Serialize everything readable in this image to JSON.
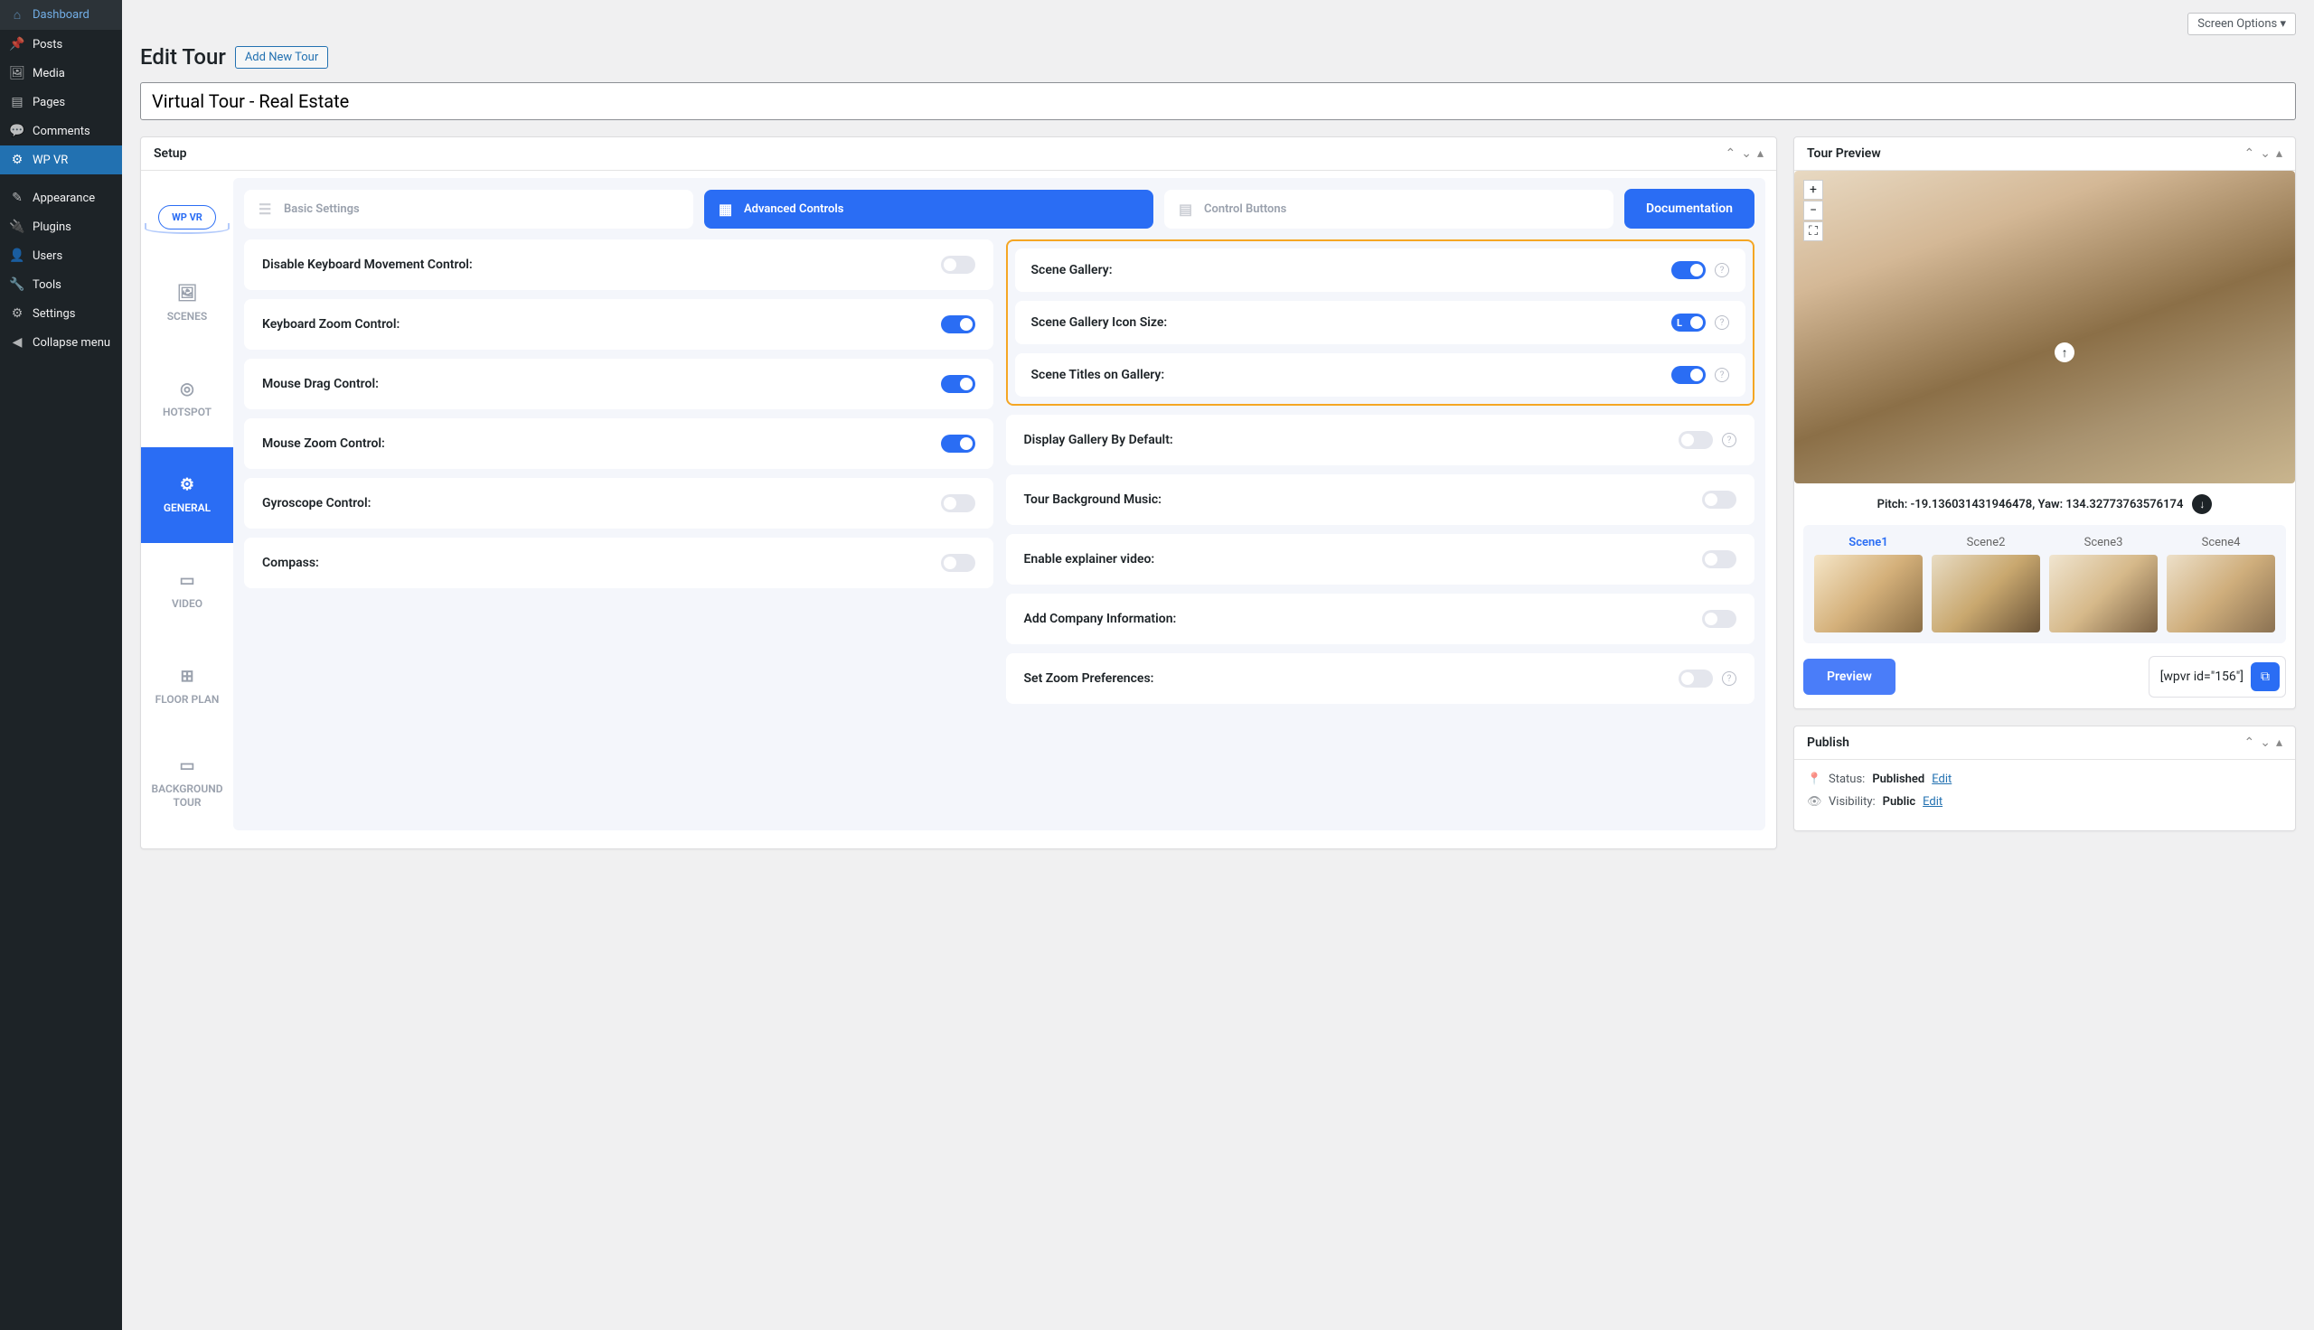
{
  "topbar": {
    "screen_options": "Screen Options"
  },
  "heading": {
    "title": "Edit Tour",
    "add_new": "Add New Tour"
  },
  "title_input": {
    "value": "Virtual Tour - Real Estate"
  },
  "admin_sidebar": {
    "items": [
      {
        "label": "Dashboard",
        "icon": "⌂"
      },
      {
        "label": "Posts",
        "icon": "📌"
      },
      {
        "label": "Media",
        "icon": "🖼"
      },
      {
        "label": "Pages",
        "icon": "▤"
      },
      {
        "label": "Comments",
        "icon": "💬"
      },
      {
        "label": "WP VR",
        "icon": "⚙",
        "active": true
      }
    ],
    "items2": [
      {
        "label": "Appearance",
        "icon": "✎"
      },
      {
        "label": "Plugins",
        "icon": "🔌"
      },
      {
        "label": "Users",
        "icon": "👤"
      },
      {
        "label": "Tools",
        "icon": "🔧"
      },
      {
        "label": "Settings",
        "icon": "⚙"
      },
      {
        "label": "Collapse menu",
        "icon": "◀"
      }
    ]
  },
  "setup_box": {
    "title": "Setup"
  },
  "setup_tabs": [
    {
      "label": "SCENES",
      "icon": "🖼"
    },
    {
      "label": "HOTSPOT",
      "icon": "◎"
    },
    {
      "label": "GENERAL",
      "icon": "⚙",
      "active": true
    },
    {
      "label": "VIDEO",
      "icon": "▭"
    },
    {
      "label": "FLOOR PLAN",
      "icon": "⊞"
    },
    {
      "label": "BACKGROUND TOUR",
      "icon": "▭"
    }
  ],
  "wpvr_badge": "WP VR",
  "content_tabs": {
    "basic": "Basic Settings",
    "advanced": "Advanced Controls",
    "control": "Control Buttons",
    "doc": "Documentation"
  },
  "controls_left": [
    {
      "label": "Disable Keyboard Movement Control:",
      "on": false
    },
    {
      "label": "Keyboard Zoom Control:",
      "on": true
    },
    {
      "label": "Mouse Drag Control:",
      "on": true
    },
    {
      "label": "Mouse Zoom Control:",
      "on": true
    },
    {
      "label": "Gyroscope Control:",
      "on": false
    },
    {
      "label": "Compass:",
      "on": false
    }
  ],
  "controls_right_hl": [
    {
      "label": "Scene Gallery:",
      "on": true,
      "info": true
    },
    {
      "label": "Scene Gallery Icon Size:",
      "on": true,
      "info": true,
      "badge": "L"
    },
    {
      "label": "Scene Titles on Gallery:",
      "on": true,
      "info": true
    }
  ],
  "controls_right": [
    {
      "label": "Display Gallery By Default:",
      "on": false,
      "info": true
    },
    {
      "label": "Tour Background Music:",
      "on": false
    },
    {
      "label": "Enable explainer video:",
      "on": false
    },
    {
      "label": "Add Company Information:",
      "on": false
    },
    {
      "label": "Set Zoom Preferences:",
      "on": false,
      "info": true
    }
  ],
  "preview_box": {
    "title": "Tour Preview"
  },
  "preview": {
    "meta": "Pitch: -19.136031431946478, Yaw: 134.32773763576174",
    "scenes": [
      {
        "label": "Scene1",
        "active": true
      },
      {
        "label": "Scene2"
      },
      {
        "label": "Scene3"
      },
      {
        "label": "Scene4"
      }
    ],
    "preview_btn": "Preview",
    "shortcode": "[wpvr id=\"156\"]"
  },
  "publish_box": {
    "title": "Publish"
  },
  "publish": {
    "status_label": "Status:",
    "status_value": "Published",
    "visibility_label": "Visibility:",
    "visibility_value": "Public",
    "edit": "Edit"
  }
}
